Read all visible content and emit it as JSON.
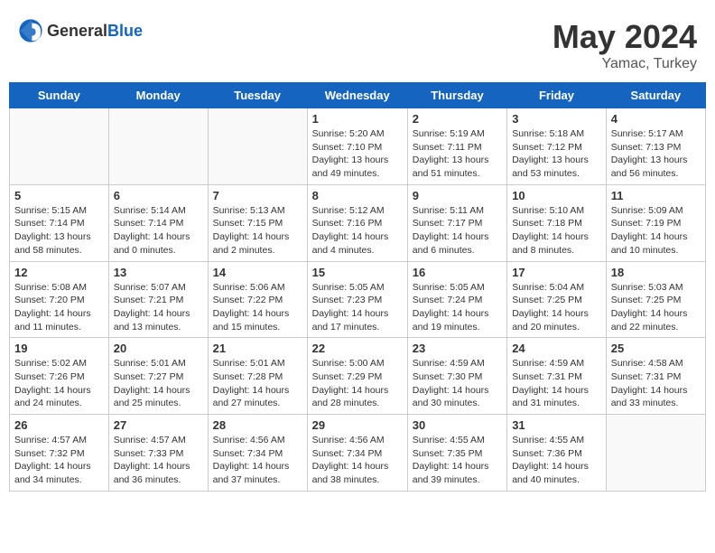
{
  "header": {
    "logo_general": "General",
    "logo_blue": "Blue",
    "main_title": "May 2024",
    "subtitle": "Yamac, Turkey"
  },
  "days_of_week": [
    "Sunday",
    "Monday",
    "Tuesday",
    "Wednesday",
    "Thursday",
    "Friday",
    "Saturday"
  ],
  "weeks": [
    [
      {
        "day": "",
        "info": ""
      },
      {
        "day": "",
        "info": ""
      },
      {
        "day": "",
        "info": ""
      },
      {
        "day": "1",
        "info": "Sunrise: 5:20 AM\nSunset: 7:10 PM\nDaylight: 13 hours and 49 minutes."
      },
      {
        "day": "2",
        "info": "Sunrise: 5:19 AM\nSunset: 7:11 PM\nDaylight: 13 hours and 51 minutes."
      },
      {
        "day": "3",
        "info": "Sunrise: 5:18 AM\nSunset: 7:12 PM\nDaylight: 13 hours and 53 minutes."
      },
      {
        "day": "4",
        "info": "Sunrise: 5:17 AM\nSunset: 7:13 PM\nDaylight: 13 hours and 56 minutes."
      }
    ],
    [
      {
        "day": "5",
        "info": "Sunrise: 5:15 AM\nSunset: 7:14 PM\nDaylight: 13 hours and 58 minutes."
      },
      {
        "day": "6",
        "info": "Sunrise: 5:14 AM\nSunset: 7:14 PM\nDaylight: 14 hours and 0 minutes."
      },
      {
        "day": "7",
        "info": "Sunrise: 5:13 AM\nSunset: 7:15 PM\nDaylight: 14 hours and 2 minutes."
      },
      {
        "day": "8",
        "info": "Sunrise: 5:12 AM\nSunset: 7:16 PM\nDaylight: 14 hours and 4 minutes."
      },
      {
        "day": "9",
        "info": "Sunrise: 5:11 AM\nSunset: 7:17 PM\nDaylight: 14 hours and 6 minutes."
      },
      {
        "day": "10",
        "info": "Sunrise: 5:10 AM\nSunset: 7:18 PM\nDaylight: 14 hours and 8 minutes."
      },
      {
        "day": "11",
        "info": "Sunrise: 5:09 AM\nSunset: 7:19 PM\nDaylight: 14 hours and 10 minutes."
      }
    ],
    [
      {
        "day": "12",
        "info": "Sunrise: 5:08 AM\nSunset: 7:20 PM\nDaylight: 14 hours and 11 minutes."
      },
      {
        "day": "13",
        "info": "Sunrise: 5:07 AM\nSunset: 7:21 PM\nDaylight: 14 hours and 13 minutes."
      },
      {
        "day": "14",
        "info": "Sunrise: 5:06 AM\nSunset: 7:22 PM\nDaylight: 14 hours and 15 minutes."
      },
      {
        "day": "15",
        "info": "Sunrise: 5:05 AM\nSunset: 7:23 PM\nDaylight: 14 hours and 17 minutes."
      },
      {
        "day": "16",
        "info": "Sunrise: 5:05 AM\nSunset: 7:24 PM\nDaylight: 14 hours and 19 minutes."
      },
      {
        "day": "17",
        "info": "Sunrise: 5:04 AM\nSunset: 7:25 PM\nDaylight: 14 hours and 20 minutes."
      },
      {
        "day": "18",
        "info": "Sunrise: 5:03 AM\nSunset: 7:25 PM\nDaylight: 14 hours and 22 minutes."
      }
    ],
    [
      {
        "day": "19",
        "info": "Sunrise: 5:02 AM\nSunset: 7:26 PM\nDaylight: 14 hours and 24 minutes."
      },
      {
        "day": "20",
        "info": "Sunrise: 5:01 AM\nSunset: 7:27 PM\nDaylight: 14 hours and 25 minutes."
      },
      {
        "day": "21",
        "info": "Sunrise: 5:01 AM\nSunset: 7:28 PM\nDaylight: 14 hours and 27 minutes."
      },
      {
        "day": "22",
        "info": "Sunrise: 5:00 AM\nSunset: 7:29 PM\nDaylight: 14 hours and 28 minutes."
      },
      {
        "day": "23",
        "info": "Sunrise: 4:59 AM\nSunset: 7:30 PM\nDaylight: 14 hours and 30 minutes."
      },
      {
        "day": "24",
        "info": "Sunrise: 4:59 AM\nSunset: 7:31 PM\nDaylight: 14 hours and 31 minutes."
      },
      {
        "day": "25",
        "info": "Sunrise: 4:58 AM\nSunset: 7:31 PM\nDaylight: 14 hours and 33 minutes."
      }
    ],
    [
      {
        "day": "26",
        "info": "Sunrise: 4:57 AM\nSunset: 7:32 PM\nDaylight: 14 hours and 34 minutes."
      },
      {
        "day": "27",
        "info": "Sunrise: 4:57 AM\nSunset: 7:33 PM\nDaylight: 14 hours and 36 minutes."
      },
      {
        "day": "28",
        "info": "Sunrise: 4:56 AM\nSunset: 7:34 PM\nDaylight: 14 hours and 37 minutes."
      },
      {
        "day": "29",
        "info": "Sunrise: 4:56 AM\nSunset: 7:34 PM\nDaylight: 14 hours and 38 minutes."
      },
      {
        "day": "30",
        "info": "Sunrise: 4:55 AM\nSunset: 7:35 PM\nDaylight: 14 hours and 39 minutes."
      },
      {
        "day": "31",
        "info": "Sunrise: 4:55 AM\nSunset: 7:36 PM\nDaylight: 14 hours and 40 minutes."
      },
      {
        "day": "",
        "info": ""
      }
    ]
  ]
}
